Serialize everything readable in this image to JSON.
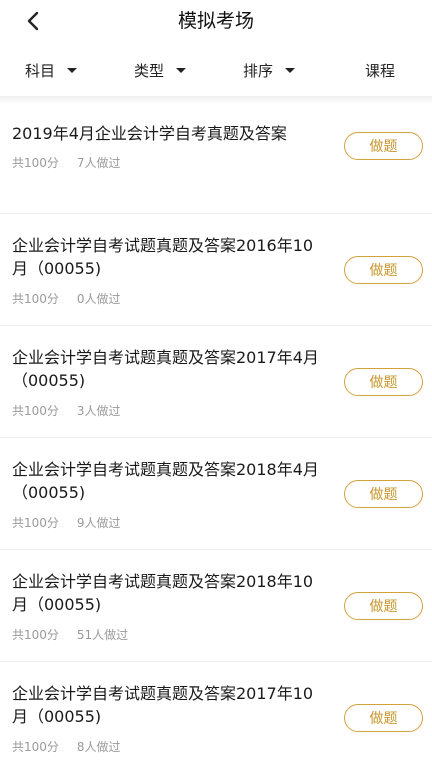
{
  "header": {
    "title": "模拟考场"
  },
  "filters": [
    {
      "label": "科目",
      "has_caret": true
    },
    {
      "label": "类型",
      "has_caret": true
    },
    {
      "label": "排序",
      "has_caret": true
    },
    {
      "label": "课程",
      "has_caret": false
    }
  ],
  "colors": {
    "accent": "#d4a23c",
    "meta_text": "#9a9a9a"
  },
  "items": [
    {
      "title": "2019年4月企业会计学自考真题及答案",
      "score": "共100分",
      "count": "7人做过",
      "button": "做题"
    },
    {
      "title": "企业会计学自考试题真题及答案2016年10月（00055)",
      "score": "共100分",
      "count": "0人做过",
      "button": "做题"
    },
    {
      "title": "企业会计学自考试题真题及答案2017年4月（00055)",
      "score": "共100分",
      "count": "3人做过",
      "button": "做题"
    },
    {
      "title": "企业会计学自考试题真题及答案2018年4月（00055)",
      "score": "共100分",
      "count": "9人做过",
      "button": "做题"
    },
    {
      "title": "企业会计学自考试题真题及答案2018年10月（00055)",
      "score": "共100分",
      "count": "51人做过",
      "button": "做题"
    },
    {
      "title": "企业会计学自考试题真题及答案2017年10月（00055)",
      "score": "共100分",
      "count": "8人做过",
      "button": "做题"
    }
  ]
}
